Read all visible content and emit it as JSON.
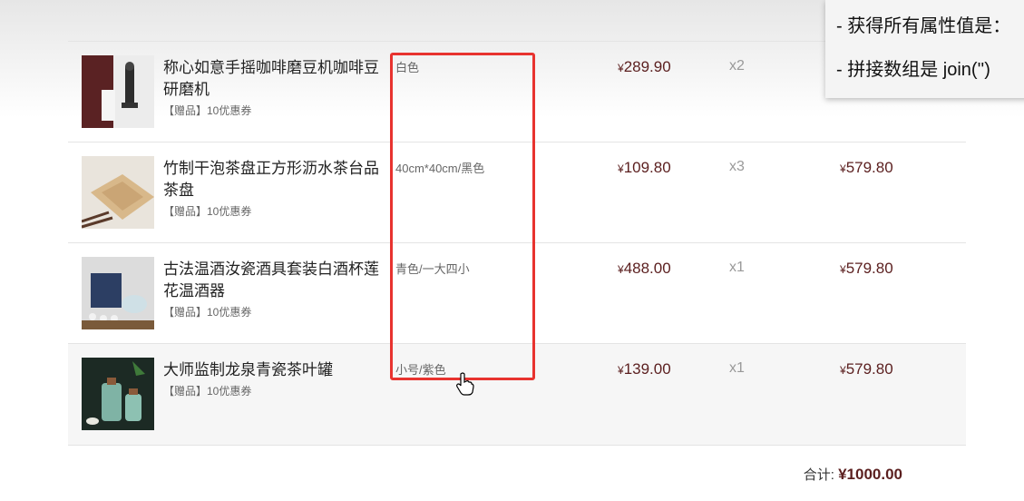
{
  "items": [
    {
      "name": "称心如意手摇咖啡磨豆机咖啡豆研磨机",
      "gift": "【赠品】10优惠券",
      "spec": "白色",
      "price": "289.90",
      "qty": "x2",
      "subtotal": ""
    },
    {
      "name": "竹制干泡茶盘正方形沥水茶台品茶盘",
      "gift": "【赠品】10优惠券",
      "spec": "40cm*40cm/黑色",
      "price": "109.80",
      "qty": "x3",
      "subtotal": "579.80"
    },
    {
      "name": "古法温酒汝瓷酒具套装白酒杯莲花温酒器",
      "gift": "【赠品】10优惠券",
      "spec": "青色/一大四小",
      "price": "488.00",
      "qty": "x1",
      "subtotal": "579.80"
    },
    {
      "name": "大师监制龙泉青瓷茶叶罐",
      "gift": "【赠品】10优惠券",
      "spec": "小号/紫色",
      "price": "139.00",
      "qty": "x1",
      "subtotal": "579.80"
    }
  ],
  "currency": "¥",
  "total": {
    "label": "合计:",
    "amount": "¥1000.00"
  },
  "note": {
    "line1": "- 获得所有属性值是：",
    "line2": "-  拼接数组是 join('')"
  },
  "colors": {
    "price": "#5b1f1f",
    "highlight": "#e8332f"
  }
}
